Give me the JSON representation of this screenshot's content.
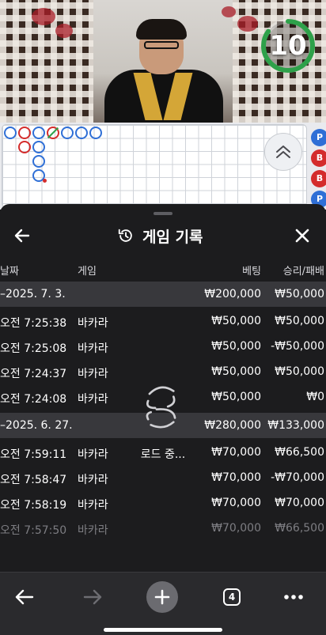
{
  "video": {
    "timer": "10",
    "timer_progress": 0.85,
    "timer_color": "#2ea14a"
  },
  "roadmap": {
    "colors": {
      "player": "#2f6fd6",
      "banker": "#d42c2c",
      "tie": "#2ea14a"
    },
    "side_chips": [
      {
        "label": "P",
        "color": "#2f6fd6"
      },
      {
        "label": "B",
        "color": "#d42c2c"
      },
      {
        "label": "B",
        "color": "#d42c2c"
      },
      {
        "label": "P",
        "color": "#2f6fd6"
      }
    ],
    "toggle_icon": "chevron-double-up-icon"
  },
  "sheet": {
    "title": "게임 기록",
    "title_icon": "history-icon",
    "back_icon": "arrow-left-icon",
    "close_icon": "close-icon",
    "columns": {
      "date": "날짜",
      "game": "게임",
      "bet": "베팅",
      "result": "승리/패배"
    },
    "groups": [
      {
        "date": "–2025. 7. 3.",
        "bet": "₩200,000",
        "result": "₩50,000",
        "rows": [
          {
            "time": "오전 7:25:38",
            "game": "바카라",
            "bet": "₩50,000",
            "result": "₩50,000"
          },
          {
            "time": "오전 7:25:08",
            "game": "바카라",
            "bet": "₩50,000",
            "result": "-₩50,000"
          },
          {
            "time": "오전 7:24:37",
            "game": "바카라",
            "bet": "₩50,000",
            "result": "₩50,000"
          },
          {
            "time": "오전 7:24:08",
            "game": "바카라",
            "bet": "₩50,000",
            "result": "₩0"
          }
        ]
      },
      {
        "date": "–2025. 6. 27.",
        "bet": "₩280,000",
        "result": "₩133,000",
        "rows": [
          {
            "time": "오전 7:59:11",
            "game": "바카라",
            "bet": "₩70,000",
            "result": "₩66,500"
          },
          {
            "time": "오전 7:58:47",
            "game": "바카라",
            "bet": "₩70,000",
            "result": "-₩70,000"
          },
          {
            "time": "오전 7:58:19",
            "game": "바카라",
            "bet": "₩70,000",
            "result": "₩70,000"
          },
          {
            "time": "오전 7:57:50",
            "game": "바카라",
            "bet": "₩70,000",
            "result": "₩66,500"
          }
        ]
      }
    ],
    "loading_text": "로드 중..."
  },
  "toolbar": {
    "back_icon": "arrow-left-icon",
    "forward_icon": "arrow-right-icon",
    "new_tab_icon": "plus-icon",
    "tab_count": "4",
    "more_icon": "more-horizontal-icon"
  }
}
